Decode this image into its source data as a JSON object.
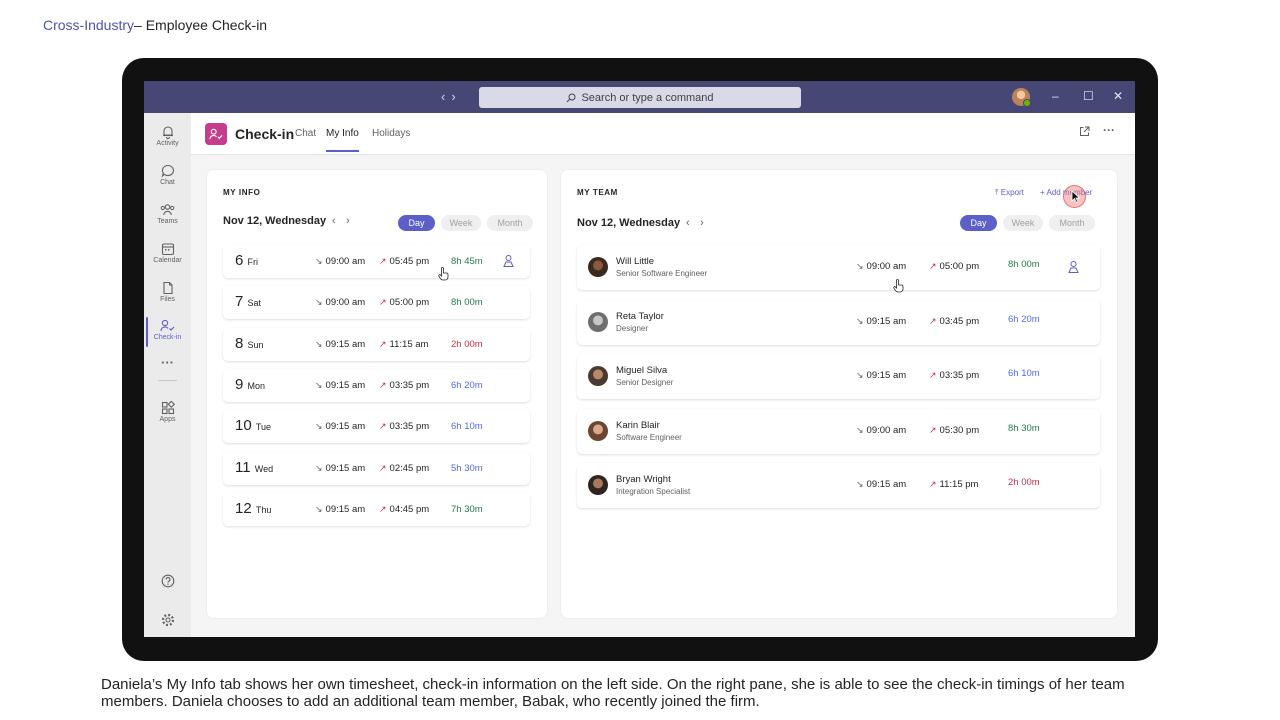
{
  "slide": {
    "title_link": "Cross-Industry",
    "title_rest": "– Employee Check-in",
    "caption": "Daniela’s My Info tab shows her own timesheet, check-in information on the left side. On the right pane, she is able to see the check-in timings of her team members. Daniela chooses to add an additional team member, Babak, who recently joined the firm."
  },
  "titlebar": {
    "search_placeholder": "Search or type a command"
  },
  "rail": [
    {
      "label": "Activity",
      "icon": "bell-icon"
    },
    {
      "label": "Chat",
      "icon": "chat-icon"
    },
    {
      "label": "Teams",
      "icon": "teams-icon"
    },
    {
      "label": "Calendar",
      "icon": "calendar-icon"
    },
    {
      "label": "Files",
      "icon": "files-icon"
    },
    {
      "label": "Check-in",
      "icon": "checkin-icon",
      "active": true
    },
    {
      "label": "Apps",
      "icon": "apps-icon"
    }
  ],
  "header": {
    "app_title": "Check-in",
    "tabs": [
      {
        "label": "Chat"
      },
      {
        "label": "My Info",
        "active": true
      },
      {
        "label": "Holidays"
      }
    ]
  },
  "my_info": {
    "title": "MY INFO",
    "date": "Nov 12, Wednesday",
    "segments": [
      "Day",
      "Week",
      "Month"
    ],
    "active_segment": "Day",
    "rows": [
      {
        "day": "6",
        "dow": "Fri",
        "in": "09:00 am",
        "out": "05:45 pm",
        "dur": "8h 45m",
        "status": "green"
      },
      {
        "day": "7",
        "dow": "Sat",
        "in": "09:00 am",
        "out": "05:00 pm",
        "dur": "8h 00m",
        "status": "green"
      },
      {
        "day": "8",
        "dow": "Sun",
        "in": "09:15 am",
        "out": "11:15 am",
        "dur": "2h 00m",
        "status": "red"
      },
      {
        "day": "9",
        "dow": "Mon",
        "in": "09:15 am",
        "out": "03:35 pm",
        "dur": "6h 20m",
        "status": "blue"
      },
      {
        "day": "10",
        "dow": "Tue",
        "in": "09:15 am",
        "out": "03:35 pm",
        "dur": "6h 10m",
        "status": "blue"
      },
      {
        "day": "11",
        "dow": "Wed",
        "in": "09:15 am",
        "out": "02:45 pm",
        "dur": "5h 30m",
        "status": "blue"
      },
      {
        "day": "12",
        "dow": "Thu",
        "in": "09:15 am",
        "out": "04:45 pm",
        "dur": "7h 30m",
        "status": "green"
      }
    ]
  },
  "my_team": {
    "title": "MY TEAM",
    "export_label": "Export",
    "add_member_label": "Add member",
    "date": "Nov 12, Wednesday",
    "segments": [
      "Day",
      "Week",
      "Month"
    ],
    "active_segment": "Day",
    "members": [
      {
        "name": "Will Little",
        "role": "Senior Software Engineer",
        "in": "09:00 am",
        "out": "05:00 pm",
        "dur": "8h 00m",
        "status": "green"
      },
      {
        "name": "Reta Taylor",
        "role": "Designer",
        "in": "09:15 am",
        "out": "03:45 pm",
        "dur": "6h 20m",
        "status": "blue"
      },
      {
        "name": "Miguel Silva",
        "role": "Senior Designer",
        "in": "09:15 am",
        "out": "03:35 pm",
        "dur": "6h 10m",
        "status": "blue"
      },
      {
        "name": "Karin Blair",
        "role": "Software Engineer",
        "in": "09:00 am",
        "out": "05:30 pm",
        "dur": "8h 30m",
        "status": "green"
      },
      {
        "name": "Bryan Wright",
        "role": "Integration Specialist",
        "in": "09:15 am",
        "out": "11:15 pm",
        "dur": "2h 00m",
        "status": "red"
      }
    ]
  },
  "colors": {
    "titlebar": "#464775",
    "accent": "#5b5fc7",
    "app_icon": "#c43e8c",
    "green": "#237b4b",
    "blue": "#4f6bed",
    "red": "#c4314b"
  }
}
